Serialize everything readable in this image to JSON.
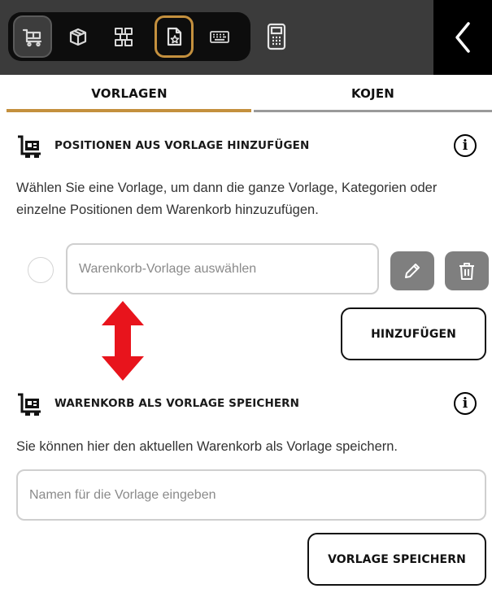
{
  "toolbar": {
    "buttons": [
      {
        "icon": "cart-icon",
        "state": "active"
      },
      {
        "icon": "package-icon",
        "state": "normal"
      },
      {
        "icon": "stacked-boxes-icon",
        "state": "normal"
      },
      {
        "icon": "document-star-icon",
        "state": "selected"
      },
      {
        "icon": "keyboard-icon",
        "state": "normal"
      }
    ],
    "calculator_icon": "calculator-icon",
    "back_icon": "chevron-left-icon"
  },
  "tabs": [
    {
      "label": "VORLAGEN",
      "active": true
    },
    {
      "label": "KOJEN",
      "active": false
    }
  ],
  "section_add": {
    "title": "POSITIONEN AUS VORLAGE HINZUFÜGEN",
    "description_line1": "Wählen Sie eine Vorlage, um dann die ganze Vorlage, Kategorien oder",
    "description_line2": "einzelne Positionen dem Warenkorb hinzuzufügen.",
    "select_placeholder": "Warenkorb-Vorlage auswählen",
    "add_button": "HINZUFÜGEN"
  },
  "section_save": {
    "title": "WARENKORB ALS VORLAGE SPEICHERN",
    "description": "Sie können hier den aktuellen Warenkorb als Vorlage speichern.",
    "name_placeholder": "Namen für die Vorlage eingeben",
    "save_button": "VORLAGE SPEICHERN"
  },
  "colors": {
    "accent": "#c4903e",
    "toolbar_bg": "#3b3b3b",
    "arrow": "#e8141c",
    "icon_button_bg": "#7f7f7f"
  }
}
